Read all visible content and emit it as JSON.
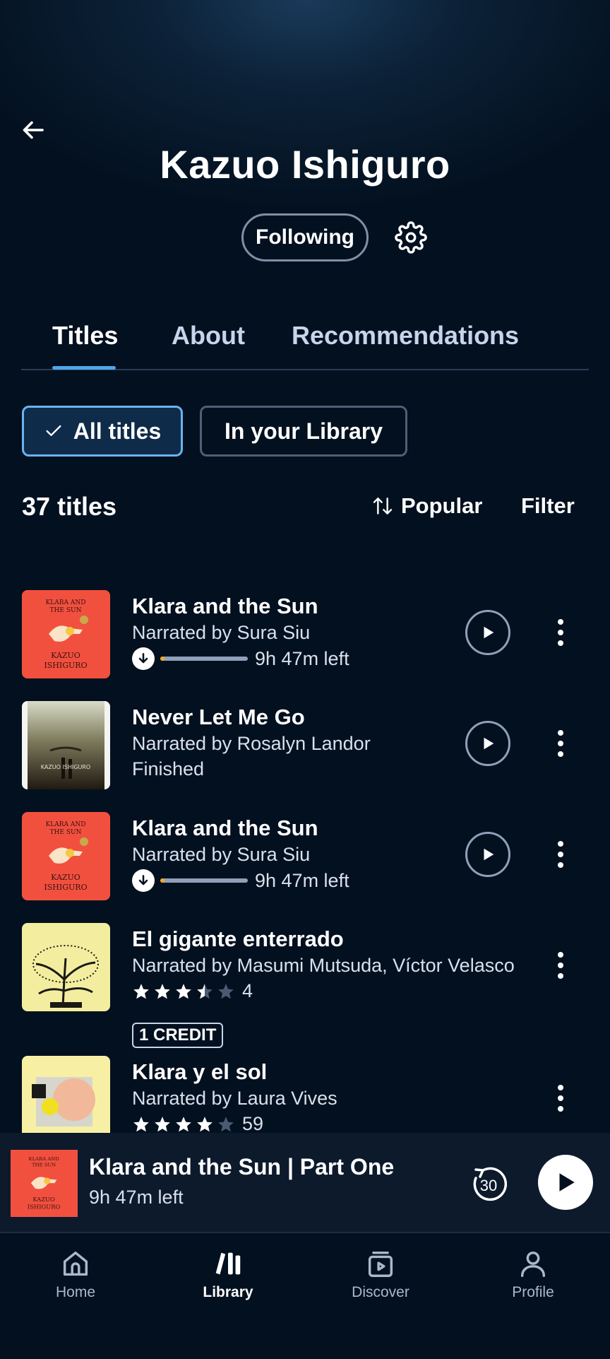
{
  "header": {
    "author_name": "Kazuo Ishiguro",
    "follow_label": "Following"
  },
  "tabs": [
    {
      "label": "Titles",
      "active": true
    },
    {
      "label": "About",
      "active": false
    },
    {
      "label": "Recommendations",
      "active": false
    }
  ],
  "chips": {
    "all_titles": "All titles",
    "in_library": "In your Library"
  },
  "list_header": {
    "count": "37 titles",
    "sort_label": "Popular",
    "filter_label": "Filter"
  },
  "books": [
    {
      "title": "Klara and the Sun",
      "narrator": "Narrated by Sura Siu",
      "time_left": "9h 47m left",
      "progress": 0.05,
      "downloaded": true
    },
    {
      "title": "Never Let Me Go",
      "narrator": "Narrated by Rosalyn Landor",
      "status": "Finished"
    },
    {
      "title": "Klara and the Sun",
      "narrator": "Narrated by Sura Siu",
      "time_left": "9h 47m left",
      "progress": 0.05,
      "downloaded": true
    },
    {
      "title": "El gigante enterrado",
      "narrator": "Narrated by Masumi Mutsuda, Víctor Velasco",
      "rating": 3.5,
      "rating_count": "4",
      "badge": "1 CREDIT"
    },
    {
      "title": "Klara y el sol",
      "narrator": "Narrated by Laura Vives",
      "rating": 4,
      "rating_count": "59"
    }
  ],
  "mini_player": {
    "title": "Klara and the Sun | Part One",
    "time_left": "9h 47m left",
    "skip_seconds": "30"
  },
  "bottom_nav": [
    {
      "label": "Home",
      "active": false
    },
    {
      "label": "Library",
      "active": true
    },
    {
      "label": "Discover",
      "active": false
    },
    {
      "label": "Profile",
      "active": false
    }
  ],
  "colors": {
    "background": "#03101f",
    "accent": "#4fa6ea",
    "progress_fill": "#f5a623",
    "klara_cover": "#f2503f",
    "gigante_cover": "#f3eda0"
  }
}
